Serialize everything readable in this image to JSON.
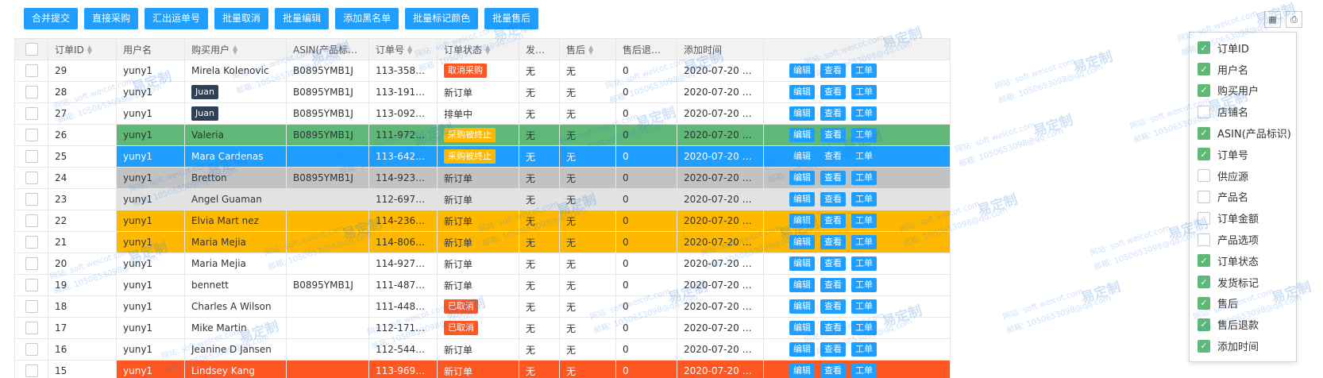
{
  "toolbar": {
    "buttons": [
      "合并提交",
      "直接采购",
      "汇出运单号",
      "批量取消",
      "批量编辑",
      "添加黑名单",
      "批量标记颜色",
      "批量售后"
    ]
  },
  "table": {
    "headers": [
      "订单ID",
      "用户名",
      "购买用户",
      "ASIN(产品标…",
      "订单号",
      "订单状态",
      "发…",
      "售后",
      "售后退款…",
      "添加时间"
    ],
    "action_labels": [
      "编辑",
      "查看",
      "工单"
    ],
    "rows": [
      {
        "id": "29",
        "user": "yuny1",
        "buyer": "Mirela Kolenovic",
        "buyer_tag": false,
        "asin": "B0895YMB1J",
        "order": "113-35833…",
        "status": "取消采购",
        "status_style": "red",
        "ship": "无",
        "after": "无",
        "refund": "0",
        "time": "2020-07-20 17:0…",
        "bg": ""
      },
      {
        "id": "28",
        "user": "yuny1",
        "buyer": "Juan",
        "buyer_tag": true,
        "asin": "B0895YMB1J",
        "order": "113-19148…",
        "status": "新订单",
        "status_style": "",
        "ship": "无",
        "after": "无",
        "refund": "0",
        "time": "2020-07-20 17:0…",
        "bg": ""
      },
      {
        "id": "27",
        "user": "yuny1",
        "buyer": "Juan",
        "buyer_tag": true,
        "asin": "B0895YMB1J",
        "order": "113-09243…",
        "status": "排单中",
        "status_style": "",
        "ship": "无",
        "after": "无",
        "refund": "0",
        "time": "2020-07-20 17:0…",
        "bg": ""
      },
      {
        "id": "26",
        "user": "yuny1",
        "buyer": "Valeria",
        "buyer_tag": false,
        "asin": "B0895YMB1J",
        "order": "111-97267…",
        "status": "采购被终止",
        "status_style": "yellow",
        "ship": "无",
        "after": "无",
        "refund": "0",
        "time": "2020-07-20 17:0…",
        "bg": "#5fb878"
      },
      {
        "id": "25",
        "user": "yuny1",
        "buyer": "Mara Cardenas",
        "buyer_tag": false,
        "asin": "",
        "order": "113-64246…",
        "status": "采购被终止",
        "status_style": "yellow",
        "ship": "无",
        "after": "无",
        "refund": "0",
        "time": "2020-07-20 17:0…",
        "bg": "#1e9fff"
      },
      {
        "id": "24",
        "user": "yuny1",
        "buyer": "Bretton",
        "buyer_tag": false,
        "asin": "B0895YMB1J",
        "order": "114-92335…",
        "status": "新订单",
        "status_style": "",
        "ship": "无",
        "after": "无",
        "refund": "0",
        "time": "2020-07-20 17:0…",
        "bg": "#c2c2c2"
      },
      {
        "id": "23",
        "user": "yuny1",
        "buyer": "Angel Guaman",
        "buyer_tag": false,
        "asin": "",
        "order": "112-69749…",
        "status": "新订单",
        "status_style": "",
        "ship": "无",
        "after": "无",
        "refund": "0",
        "time": "2020-07-20 17:0…",
        "bg": "#e2e2e2"
      },
      {
        "id": "22",
        "user": "yuny1",
        "buyer": "Elvia Mart nez",
        "buyer_tag": false,
        "asin": "",
        "order": "114-23624…",
        "status": "新订单",
        "status_style": "",
        "ship": "无",
        "after": "无",
        "refund": "0",
        "time": "2020-07-20 17:0…",
        "bg": "#ffb800"
      },
      {
        "id": "21",
        "user": "yuny1",
        "buyer": "Maria Mejia",
        "buyer_tag": false,
        "asin": "",
        "order": "114-80652…",
        "status": "新订单",
        "status_style": "",
        "ship": "无",
        "after": "无",
        "refund": "0",
        "time": "2020-07-20 17:0…",
        "bg": "#ffb800"
      },
      {
        "id": "20",
        "user": "yuny1",
        "buyer": "Maria Mejia",
        "buyer_tag": false,
        "asin": "",
        "order": "114-92772…",
        "status": "新订单",
        "status_style": "",
        "ship": "无",
        "after": "无",
        "refund": "0",
        "time": "2020-07-20 17:0…",
        "bg": ""
      },
      {
        "id": "19",
        "user": "yuny1",
        "buyer": "bennett",
        "buyer_tag": false,
        "asin": "B0895YMB1J",
        "order": "111-48797…",
        "status": "新订单",
        "status_style": "",
        "ship": "无",
        "after": "无",
        "refund": "0",
        "time": "2020-07-20 17:0…",
        "bg": ""
      },
      {
        "id": "18",
        "user": "yuny1",
        "buyer": "Charles A Wilson",
        "buyer_tag": false,
        "asin": "",
        "order": "111-44828…",
        "status": "已取消",
        "status_style": "red",
        "ship": "无",
        "after": "无",
        "refund": "0",
        "time": "2020-07-20 17:0…",
        "bg": ""
      },
      {
        "id": "17",
        "user": "yuny1",
        "buyer": "Mike Martin",
        "buyer_tag": false,
        "asin": "",
        "order": "112-17125…",
        "status": "已取消",
        "status_style": "red",
        "ship": "无",
        "after": "无",
        "refund": "0",
        "time": "2020-07-20 17:0…",
        "bg": ""
      },
      {
        "id": "16",
        "user": "yuny1",
        "buyer": "Jeanine D Jansen",
        "buyer_tag": false,
        "asin": "",
        "order": "112-54419…",
        "status": "新订单",
        "status_style": "",
        "ship": "无",
        "after": "无",
        "refund": "0",
        "time": "2020-07-20 17:0…",
        "bg": ""
      },
      {
        "id": "15",
        "user": "yuny1",
        "buyer": "Lindsey Kang",
        "buyer_tag": false,
        "asin": "",
        "order": "113-96964…",
        "status": "新订单",
        "status_style": "",
        "ship": "无",
        "after": "无",
        "refund": "0",
        "time": "2020-07-20 17:0…",
        "bg": "#ff5722"
      }
    ]
  },
  "column_panel": {
    "items": [
      {
        "label": "订单ID",
        "checked": true
      },
      {
        "label": "用户名",
        "checked": true
      },
      {
        "label": "购买用户",
        "checked": true
      },
      {
        "label": "店铺名",
        "checked": false
      },
      {
        "label": "ASIN(产品标识)",
        "checked": true
      },
      {
        "label": "订单号",
        "checked": true
      },
      {
        "label": "供应源",
        "checked": false
      },
      {
        "label": "产品名",
        "checked": false
      },
      {
        "label": "订单金额",
        "checked": false
      },
      {
        "label": "产品选项",
        "checked": false
      },
      {
        "label": "订单状态",
        "checked": true
      },
      {
        "label": "发货标记",
        "checked": true
      },
      {
        "label": "售后",
        "checked": true
      },
      {
        "label": "售后退款",
        "checked": true
      },
      {
        "label": "添加时间",
        "checked": true
      }
    ]
  },
  "watermark": {
    "brand": "易定制",
    "site": "网站: soft.weicot.com",
    "mail": "邮箱: 1050653098@qq.com"
  },
  "colors": {
    "primary": "#1e9fff",
    "green": "#5fb878",
    "orange_red": "#ff5722",
    "yellow": "#ffb800",
    "dark_tag": "#2f4056"
  }
}
